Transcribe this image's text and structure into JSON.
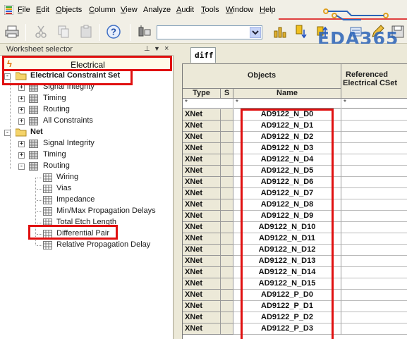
{
  "menu": {
    "items": [
      {
        "u": "F",
        "rest": "ile"
      },
      {
        "u": "E",
        "rest": "dit"
      },
      {
        "u": "O",
        "rest": "bjects"
      },
      {
        "u": "C",
        "rest": "olumn"
      },
      {
        "u": "V",
        "rest": "iew"
      },
      {
        "u": "",
        "rest": "Analyze"
      },
      {
        "u": "A",
        "rest": "udit"
      },
      {
        "u": "T",
        "rest": "ools"
      },
      {
        "u": "W",
        "rest": "indow"
      },
      {
        "u": "H",
        "rest": "elp"
      }
    ]
  },
  "toolbar": {
    "combo_value": ""
  },
  "worksheet": {
    "title": "Worksheet selector",
    "pin": "⊥",
    "dropdown": "▼",
    "close": "×",
    "electrical_label": "Electrical",
    "tree": {
      "ecset": {
        "label": "Electrical Constraint Set",
        "children": [
          "Signal Integrity",
          "Timing",
          "Routing",
          "All Constraints"
        ]
      },
      "net": {
        "label": "Net",
        "signal_integrity": "Signal Integrity",
        "timing": "Timing",
        "routing": {
          "label": "Routing",
          "children": [
            "Wiring",
            "Vias",
            "Impedance",
            "Min/Max Propagation Delays",
            "Total Etch Length",
            "Differential Pair",
            "Relative Propagation Delay"
          ]
        }
      }
    }
  },
  "sheet": {
    "tab_label": "diff",
    "headers": {
      "objects": "Objects",
      "referenced_line1": "Referenced",
      "referenced_line2": "Electrical CSet",
      "type": "Type",
      "s": "S",
      "name": "Name"
    },
    "filter": {
      "type": "*",
      "name": "*",
      "ref": "*"
    },
    "rows": [
      {
        "type": "XNet",
        "name": "AD9122_N_D0"
      },
      {
        "type": "XNet",
        "name": "AD9122_N_D1"
      },
      {
        "type": "XNet",
        "name": "AD9122_N_D2"
      },
      {
        "type": "XNet",
        "name": "AD9122_N_D3"
      },
      {
        "type": "XNet",
        "name": "AD9122_N_D4"
      },
      {
        "type": "XNet",
        "name": "AD9122_N_D5"
      },
      {
        "type": "XNet",
        "name": "AD9122_N_D6"
      },
      {
        "type": "XNet",
        "name": "AD9122_N_D7"
      },
      {
        "type": "XNet",
        "name": "AD9122_N_D8"
      },
      {
        "type": "XNet",
        "name": "AD9122_N_D9"
      },
      {
        "type": "XNet",
        "name": "AD9122_N_D10"
      },
      {
        "type": "XNet",
        "name": "AD9122_N_D11"
      },
      {
        "type": "XNet",
        "name": "AD9122_N_D12"
      },
      {
        "type": "XNet",
        "name": "AD9122_N_D13"
      },
      {
        "type": "XNet",
        "name": "AD9122_N_D14"
      },
      {
        "type": "XNet",
        "name": "AD9122_N_D15"
      },
      {
        "type": "XNet",
        "name": "AD9122_P_D0"
      },
      {
        "type": "XNet",
        "name": "AD9122_P_D1"
      },
      {
        "type": "XNet",
        "name": "AD9122_P_D2"
      },
      {
        "type": "XNet",
        "name": "AD9122_P_D3"
      }
    ]
  },
  "watermark": "EDA365",
  "colors": {
    "highlight_red": "#e01010",
    "watermark_blue": "#2a63b8"
  }
}
